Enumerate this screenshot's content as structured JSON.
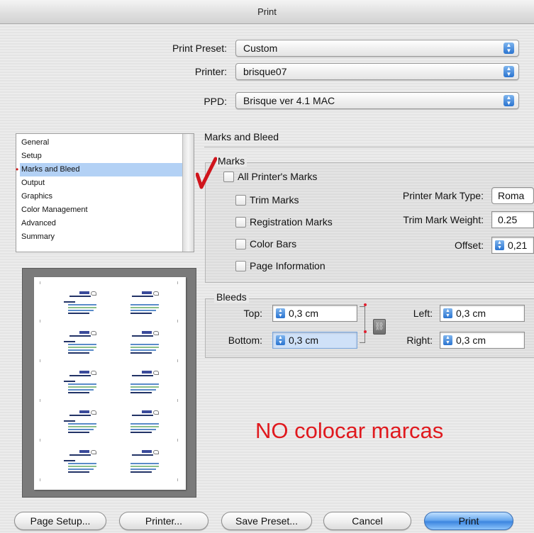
{
  "window": {
    "title": "Print"
  },
  "header": {
    "preset_label": "Print Preset:",
    "preset_value": "Custom",
    "printer_label": "Printer:",
    "printer_value": "brisque07",
    "ppd_label": "PPD:",
    "ppd_value": "Brisque ver 4.1 MAC"
  },
  "sidebar": {
    "items": [
      {
        "label": "General"
      },
      {
        "label": "Setup"
      },
      {
        "label": "Marks and Bleed",
        "selected": true
      },
      {
        "label": "Output"
      },
      {
        "label": "Graphics"
      },
      {
        "label": "Color Management"
      },
      {
        "label": "Advanced"
      },
      {
        "label": "Summary"
      }
    ]
  },
  "section": {
    "title": "Marks and Bleed",
    "marks": {
      "group_title": "Marks",
      "all_printers_marks": "All Printer's Marks",
      "trim_marks": "Trim Marks",
      "registration_marks": "Registration Marks",
      "color_bars": "Color Bars",
      "page_information": "Page Information",
      "printer_mark_type_label": "Printer Mark Type:",
      "printer_mark_type_value": "Roma",
      "trim_mark_weight_label": "Trim Mark Weight:",
      "trim_mark_weight_value": "0.25",
      "offset_label": "Offset:",
      "offset_value": "0,21"
    },
    "bleeds": {
      "group_title": "Bleeds",
      "top_label": "Top:",
      "top_value": "0,3 cm",
      "bottom_label": "Bottom:",
      "bottom_value": "0,3 cm",
      "left_label": "Left:",
      "left_value": "0,3 cm",
      "right_label": "Right:",
      "right_value": "0,3 cm"
    }
  },
  "annotation": {
    "text": "NO colocar marcas",
    "color": "#e0191e"
  },
  "footer": {
    "page_setup": "Page Setup...",
    "printer": "Printer...",
    "save_preset": "Save Preset...",
    "cancel": "Cancel",
    "print": "Print"
  },
  "colors": {
    "accent": "#3d86e0",
    "selection": "#b3d1f5"
  }
}
